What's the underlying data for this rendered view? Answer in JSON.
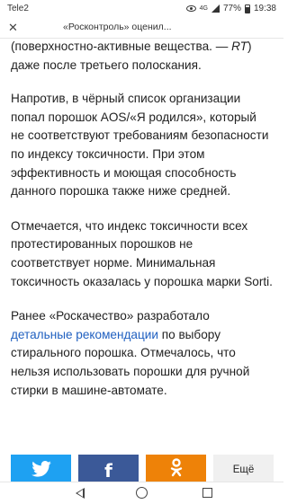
{
  "status_bar": {
    "carrier": "Tele2",
    "network": "4G",
    "battery": "77%",
    "time": "19:38"
  },
  "browser": {
    "page_title": "«Росконтроль» оценил..."
  },
  "article": {
    "p1_text": "(поверхностно-активные вещества. — ",
    "p1_source": "RT",
    "p1_end": ") даже после третьего полоскания.",
    "p2": "Напротив, в чёрный список организации попал порошок AOS/«Я родился», который не соответствуют требованиям безопасности по индексу токсичности. При этом эффективность и моющая способность данного порошка также ниже средней.",
    "p3": "Отмечается, что индекс токсичности всех протестированных порошков не соответствует норме. Минимальная токсичность оказалась у порошка марки Sorti.",
    "p4_start": "Ранее «Роскачество» разработало ",
    "p4_link": "детальные рекомендации",
    "p4_end": " по выбору стирального порошка. Отмечалось, что нельзя использовать порошки для ручной стирки в машине-автомате."
  },
  "share": {
    "facebook_letter": "f",
    "more_label": "Ещё"
  },
  "colors": {
    "twitter": "#1ea1f2",
    "facebook": "#3b5998",
    "odnoklassniki": "#ee8208",
    "link": "#2060c0"
  }
}
